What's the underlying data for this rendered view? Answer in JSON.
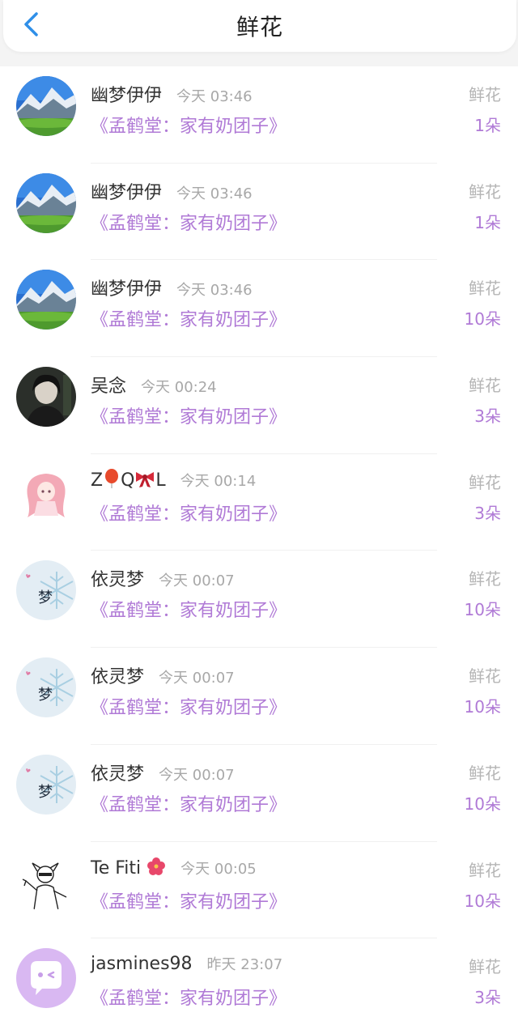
{
  "header": {
    "title": "鲜花"
  },
  "rows": [
    {
      "name": "幽梦伊伊",
      "time": "今天 03:46",
      "book": "《孟鹤堂：家有奶团子》",
      "gift": "鲜花",
      "count": "1朵",
      "avatar": "mountain-avatar"
    },
    {
      "name": "幽梦伊伊",
      "time": "今天 03:46",
      "book": "《孟鹤堂：家有奶团子》",
      "gift": "鲜花",
      "count": "1朵",
      "avatar": "mountain-avatar"
    },
    {
      "name": "幽梦伊伊",
      "time": "今天 03:46",
      "book": "《孟鹤堂：家有奶团子》",
      "gift": "鲜花",
      "count": "10朵",
      "avatar": "mountain-avatar"
    },
    {
      "name": "吴念",
      "time": "今天 00:24",
      "book": "《孟鹤堂：家有奶团子》",
      "gift": "鲜花",
      "count": "3朵",
      "avatar": "dark-character-avatar"
    },
    {
      "name_parts": [
        "Z",
        "Q",
        "L"
      ],
      "time": "今天 00:14",
      "book": "《孟鹤堂：家有奶团子》",
      "gift": "鲜花",
      "count": "3朵",
      "avatar": "anime-girl-avatar"
    },
    {
      "name": "依灵梦",
      "time": "今天 00:07",
      "book": "《孟鹤堂：家有奶团子》",
      "gift": "鲜花",
      "count": "10朵",
      "avatar": "snowflake-avatar"
    },
    {
      "name": "依灵梦",
      "time": "今天 00:07",
      "book": "《孟鹤堂：家有奶团子》",
      "gift": "鲜花",
      "count": "10朵",
      "avatar": "snowflake-avatar"
    },
    {
      "name": "依灵梦",
      "time": "今天 00:07",
      "book": "《孟鹤堂：家有奶团子》",
      "gift": "鲜花",
      "count": "10朵",
      "avatar": "snowflake-avatar"
    },
    {
      "name": "Te Fiti",
      "time": "今天 00:05",
      "book": "《孟鹤堂：家有奶团子》",
      "gift": "鲜花",
      "count": "10朵",
      "avatar": "sketch-avatar"
    },
    {
      "name": "jasmines98",
      "time": "昨天 23:07",
      "book": "《孟鹤堂：家有奶团子》",
      "gift": "鲜花",
      "count": "3朵",
      "avatar": "chat-bubble-avatar"
    }
  ],
  "colors": {
    "accent": "#b07ad6",
    "back": "#2f8fe8",
    "time": "#a8a8a8"
  }
}
